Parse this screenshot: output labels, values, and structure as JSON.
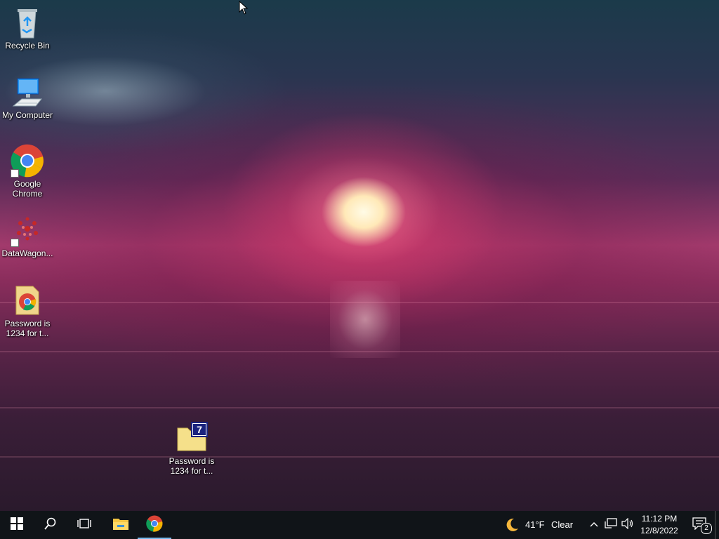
{
  "desktop": {
    "icons": [
      {
        "label": "Recycle Bin",
        "icon": "recycle-bin-icon"
      },
      {
        "label": "My Computer",
        "icon": "computer-icon"
      },
      {
        "label": "Google Chrome",
        "icon": "chrome-icon"
      },
      {
        "label": "DataWagon...",
        "icon": "datawagon-icon"
      },
      {
        "label": "Password is 1234 for t...",
        "icon": "chrome-file-icon"
      },
      {
        "label": "Password is 1234 for t...",
        "icon": "7zip-archive-icon"
      }
    ]
  },
  "taskbar": {
    "weather": {
      "temperature": "41°F",
      "condition": "Clear",
      "icon": "moon-icon"
    },
    "clock": {
      "time": "11:12 PM",
      "date": "12/8/2022"
    },
    "notifications": {
      "count": "2"
    },
    "pinned": [
      "start-icon",
      "search-icon",
      "task-view-icon",
      "file-explorer-icon",
      "chrome-icon"
    ],
    "active_app": "chrome"
  },
  "colors": {
    "taskbar_bg": "#101418",
    "active_indicator": "#76b9ed"
  }
}
